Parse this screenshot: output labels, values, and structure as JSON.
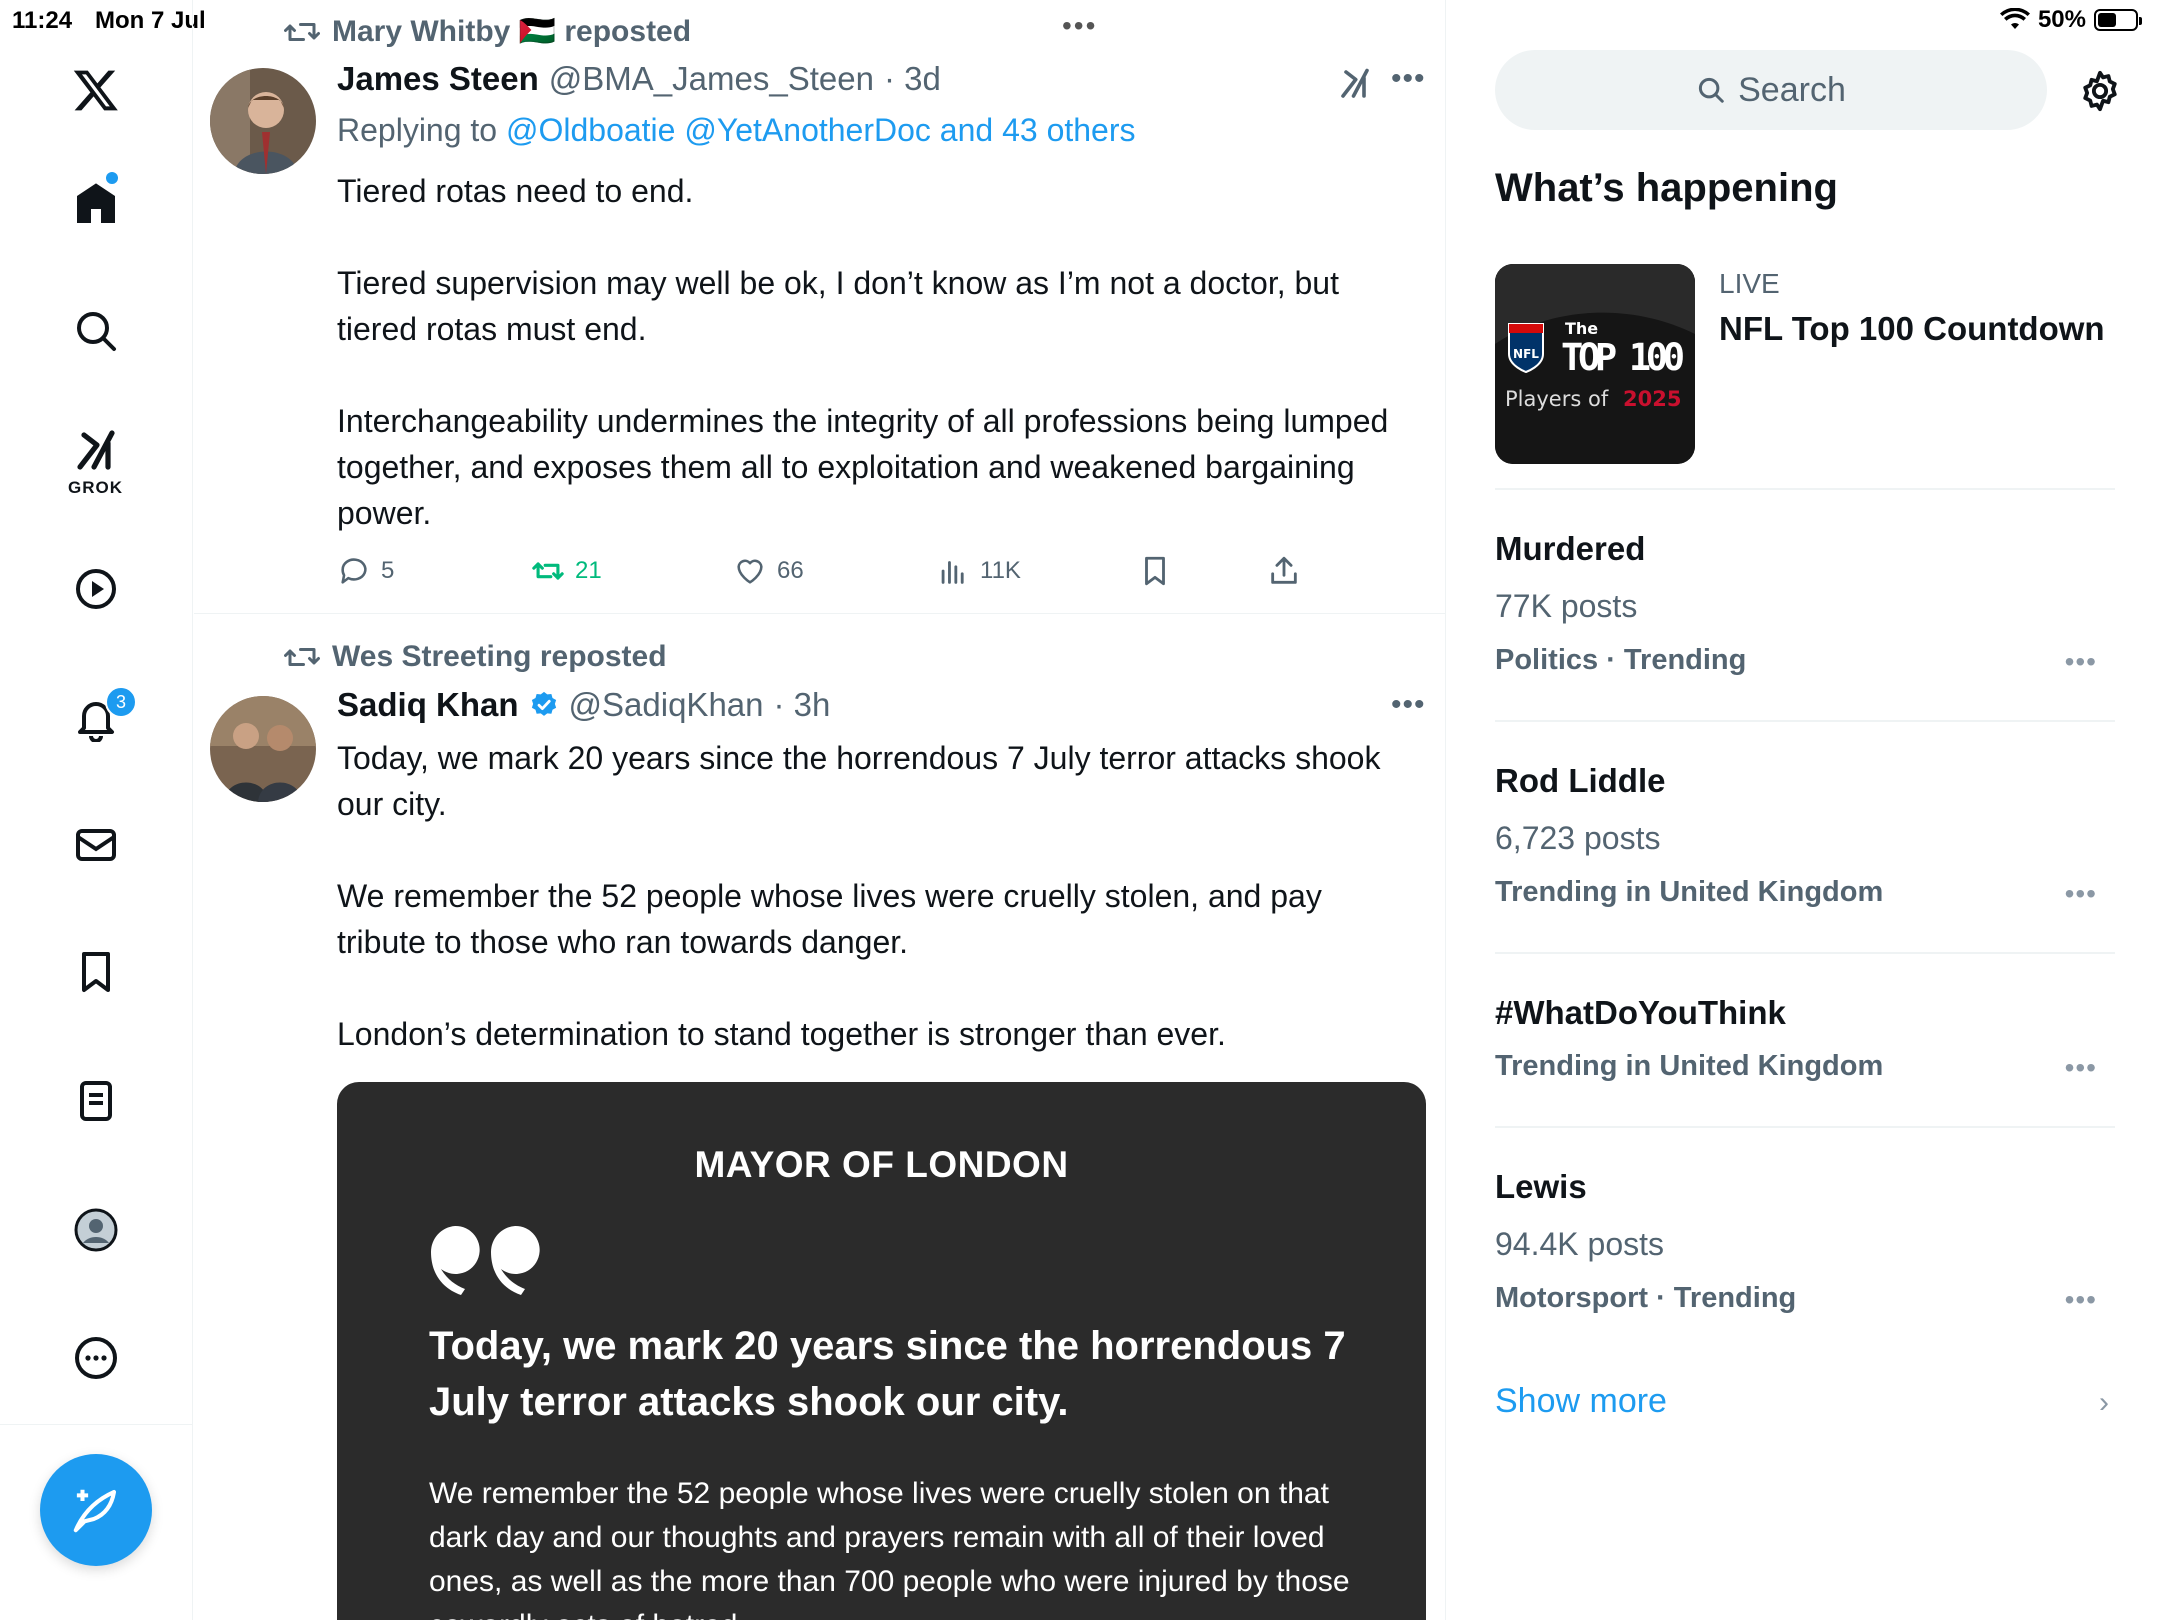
{
  "status_bar": {
    "time": "11:24",
    "date": "Mon 7 Jul",
    "battery": "50%",
    "battery_level": 0.5
  },
  "nav": {
    "notifications_badge": "3",
    "grok_label": "GROK",
    "accent": "#1d9bf0"
  },
  "posts": [
    {
      "repost_by": "Mary Whitby 🇵🇸 reposted",
      "name": "James Steen",
      "handle": "@BMA_James_Steen",
      "time": "· 3d",
      "reply_prefix": "Replying to ",
      "reply_targets": "@Oldboatie @YetAnotherDoc and 43 others",
      "paragraphs": [
        "Tiered rotas need to end.",
        "Tiered supervision may well be ok, I don’t know as I’m not a doctor, but tiered rotas must end.",
        "Interchangeability undermines the integrity of all professions being lumped together, and exposes them all to exploitation and weakened bargaining power."
      ],
      "stats": {
        "replies": "5",
        "reposts": "21",
        "likes": "66",
        "views": "11K"
      }
    },
    {
      "repost_by": "Wes Streeting reposted",
      "name": "Sadiq Khan",
      "handle": "@SadiqKhan",
      "time": "· 3h",
      "verified": true,
      "paragraphs": [
        "Today, we mark 20 years since the horrendous 7 July terror attacks shook our city.",
        "We remember the 52 people whose lives were cruelly stolen, and pay tribute to those who ran towards danger.",
        "London’s determination to stand together is stronger than ever."
      ],
      "media": {
        "title": "MAYOR OF LONDON",
        "headline": "Today, we mark 20 years since the horrendous 7 July terror attacks shook our city.",
        "body": "We remember the 52 people whose lives were cruelly stolen on that dark day and our thoughts and prayers remain with all of their loved ones, as well as the more than 700 people who were injured by those cowardly acts of hatred."
      }
    }
  ],
  "sidebar": {
    "search_placeholder": "Search",
    "whats_happening": "What’s happening",
    "live": {
      "label": "LIVE",
      "title": "NFL Top 100 Countdown",
      "image_text_the": "The",
      "image_text_top100": "TOP 100",
      "image_text_players": "Players of",
      "image_text_year": "2025",
      "image_text_nfl": "NFL"
    },
    "trends": [
      {
        "title": "Murdered",
        "count": "77K posts",
        "meta": "Politics · Trending"
      },
      {
        "title": "Rod Liddle",
        "count": "6,723 posts",
        "meta": "Trending in United Kingdom"
      },
      {
        "title": "#WhatDoYouThink",
        "count": "",
        "meta": "Trending in United Kingdom"
      },
      {
        "title": "Lewis",
        "count": "94.4K posts",
        "meta": "Motorsport · Trending"
      }
    ],
    "show_more": "Show more"
  }
}
